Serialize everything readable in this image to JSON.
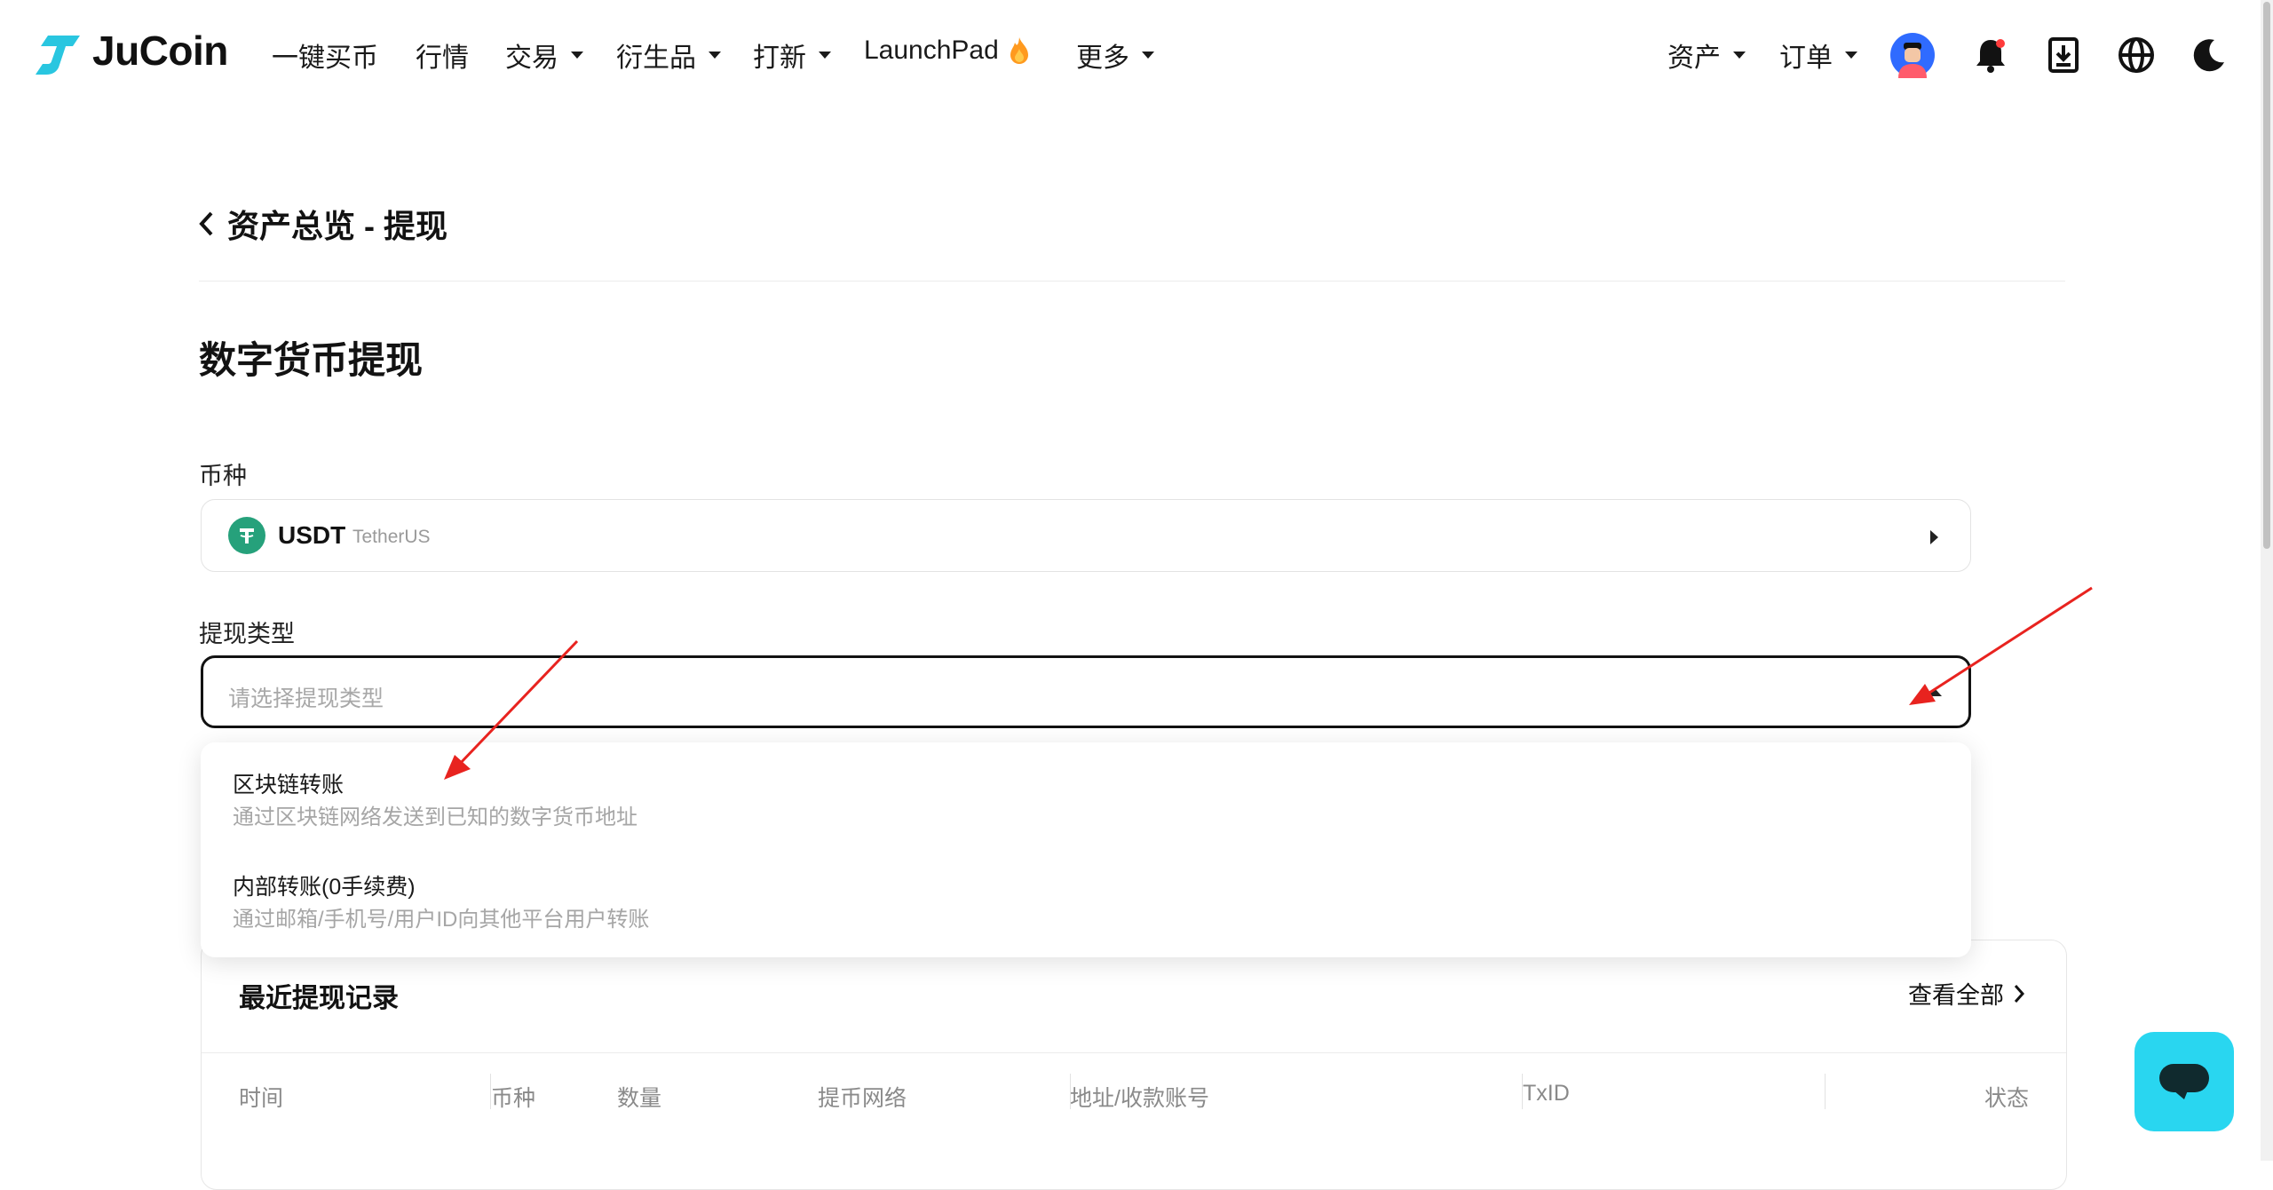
{
  "brand": {
    "name": "JuCoin",
    "accent": "#29c6e0"
  },
  "nav": {
    "items": [
      {
        "label": "一键买币",
        "dropdown": false
      },
      {
        "label": "行情",
        "dropdown": false
      },
      {
        "label": "交易",
        "dropdown": true
      },
      {
        "label": "衍生品",
        "dropdown": true
      },
      {
        "label": "打新",
        "dropdown": true
      },
      {
        "label": "LaunchPad",
        "dropdown": false,
        "icon": "fire-icon"
      },
      {
        "label": "更多",
        "dropdown": true
      }
    ],
    "right": {
      "assets": "资产",
      "orders": "订单",
      "icons": [
        "avatar",
        "bell-icon",
        "download-icon",
        "globe-icon",
        "moon-icon"
      ]
    }
  },
  "page": {
    "breadcrumb": "资产总览 - 提现",
    "title": "数字货币提现",
    "coin_label": "币种",
    "coin": {
      "symbol": "USDT",
      "name": "TetherUS",
      "color": "#26a17b"
    },
    "withdraw_type_label": "提现类型",
    "withdraw_type_placeholder": "请选择提现类型",
    "options": [
      {
        "title": "区块链转账",
        "desc": "通过区块链网络发送到已知的数字货币地址"
      },
      {
        "title": "内部转账(0手续费)",
        "desc": "通过邮箱/手机号/用户ID向其他平台用户转账"
      }
    ]
  },
  "records": {
    "title": "最近提现记录",
    "view_all": "查看全部",
    "columns": [
      "时间",
      "币种",
      "数量",
      "提币网络",
      "地址/收款账号",
      "TxID",
      "状态"
    ]
  },
  "annotations": {
    "arrow_color": "#e8231f"
  }
}
